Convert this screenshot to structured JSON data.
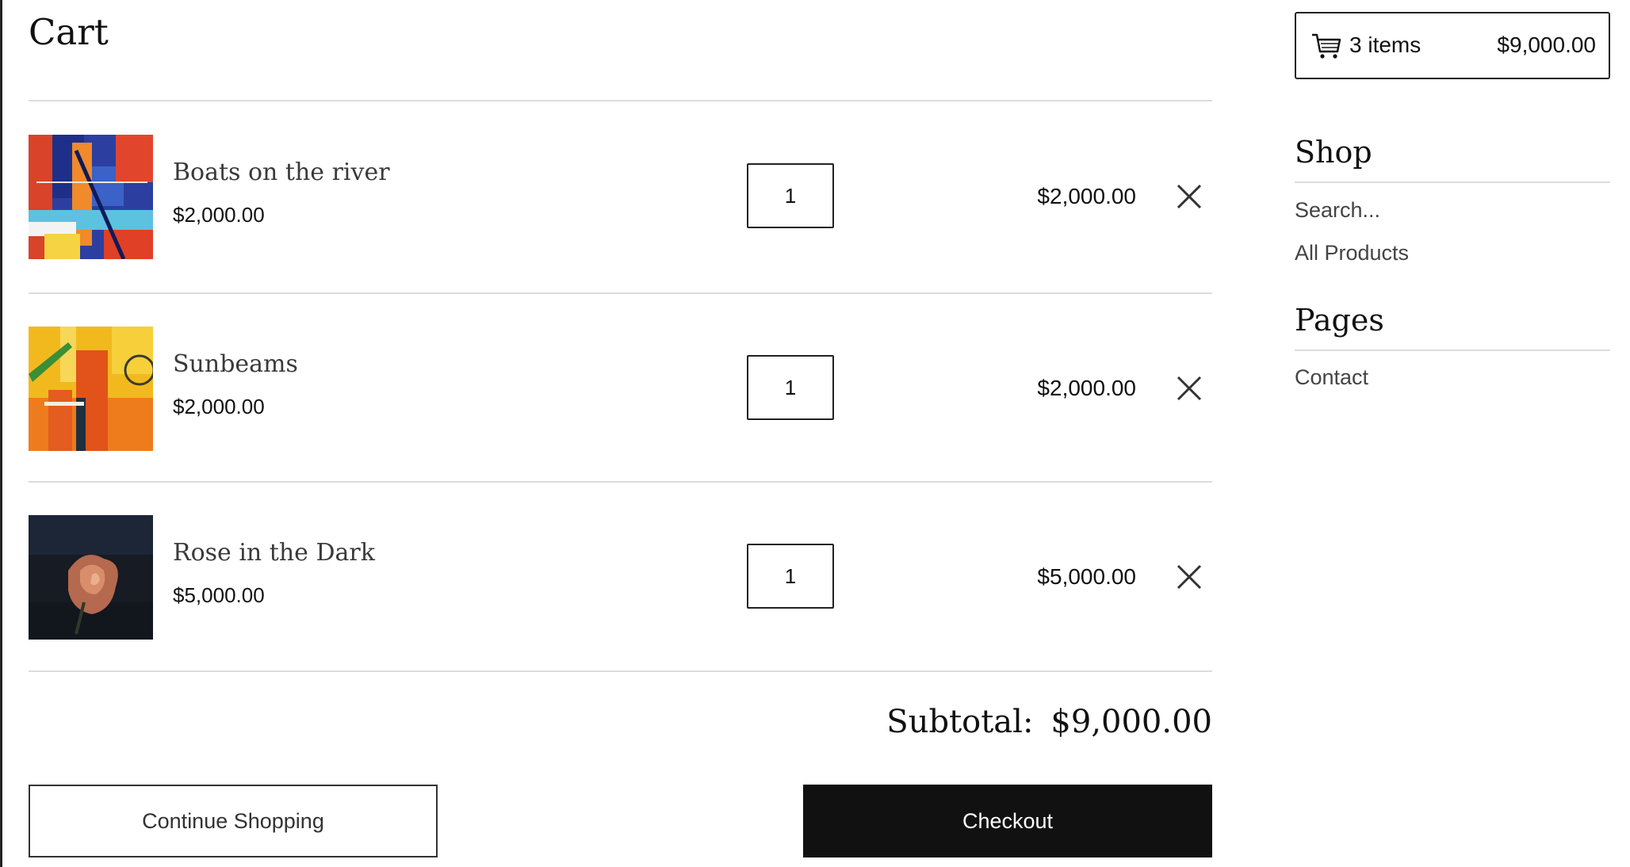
{
  "cart": {
    "title": "Cart",
    "items": [
      {
        "name": "Boats on the river",
        "price": "$2,000.00",
        "quantity": "1",
        "line_total": "$2,000.00"
      },
      {
        "name": "Sunbeams",
        "price": "$2,000.00",
        "quantity": "1",
        "line_total": "$2,000.00"
      },
      {
        "name": "Rose in the Dark",
        "price": "$5,000.00",
        "quantity": "1",
        "line_total": "$5,000.00"
      }
    ],
    "subtotal_label": "Subtotal:",
    "subtotal_value": "$9,000.00",
    "continue_label": "Continue Shopping",
    "checkout_label": "Checkout"
  },
  "mini_cart": {
    "icon": "cart-icon",
    "count": "3 items",
    "total": "$9,000.00"
  },
  "sidebar": {
    "shop_heading": "Shop",
    "search_label": "Search...",
    "all_products_label": "All Products",
    "pages_heading": "Pages",
    "contact_label": "Contact"
  },
  "colors": {
    "primary_button": "#111111",
    "divider": "#dcdcdc",
    "text_muted": "#444444"
  }
}
